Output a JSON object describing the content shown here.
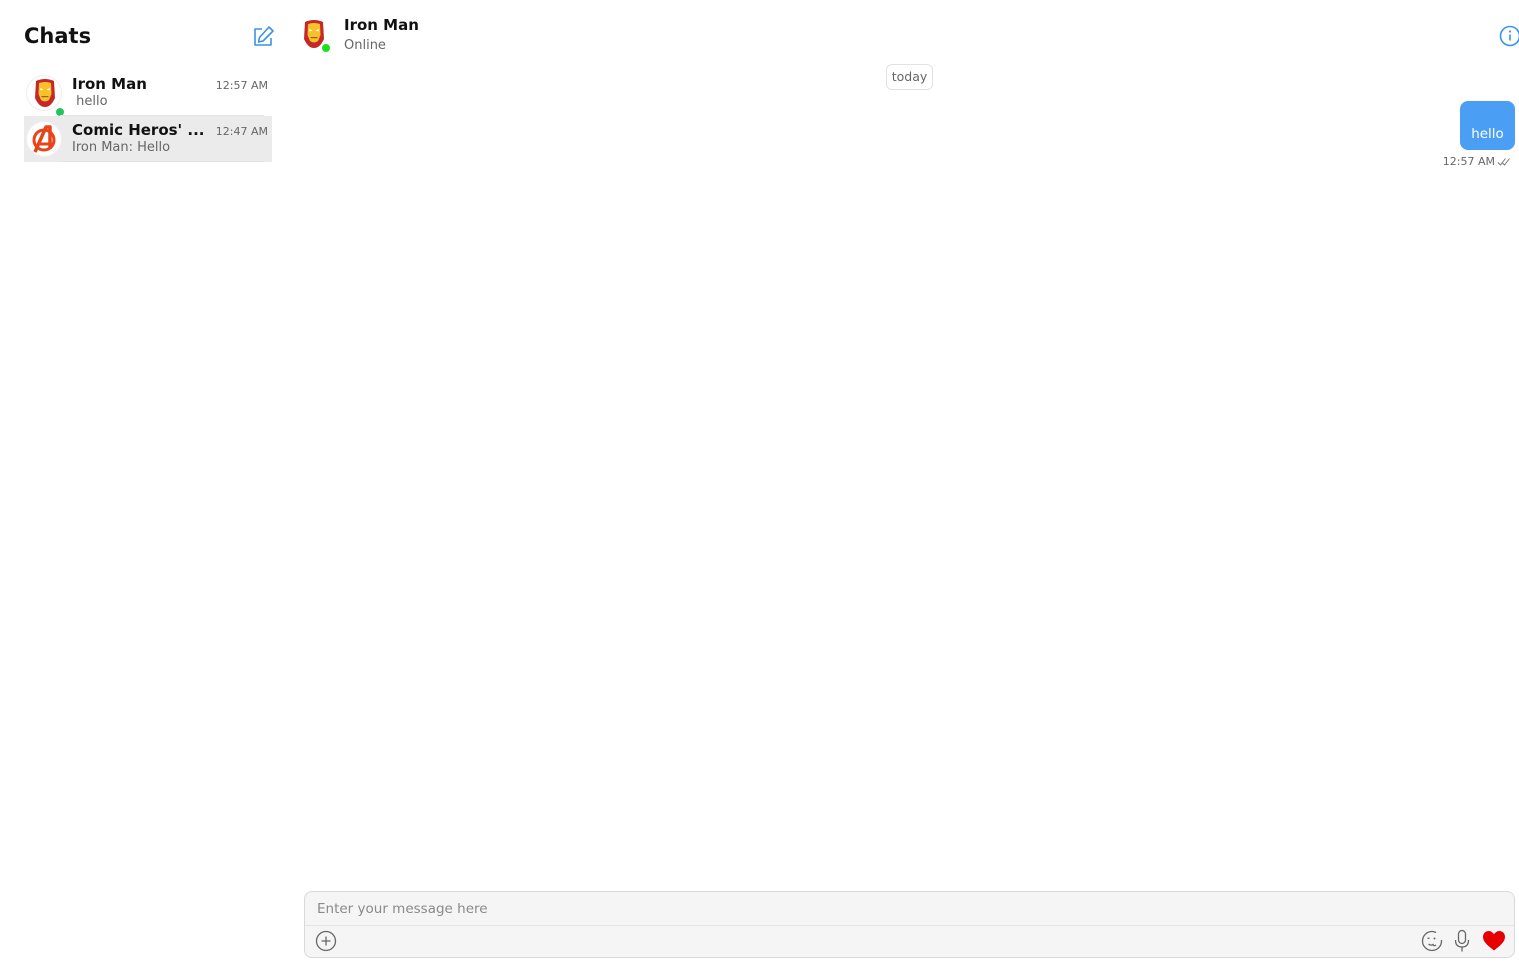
{
  "sidebar": {
    "title": "Chats",
    "compose_icon": "compose-edit-icon",
    "chats": [
      {
        "name": "Iron Man",
        "preview": " hello",
        "time": "12:57 AM",
        "avatar": "iron-man-avatar",
        "online": true
      },
      {
        "name": "Comic Heros' ...",
        "preview": "Iron Man: Hello",
        "time": "12:47 AM",
        "avatar": "avengers-avatar",
        "online": false
      }
    ]
  },
  "conversation": {
    "name": "Iron Man",
    "status": "Online",
    "info_icon": "info-icon",
    "date_separator": "today",
    "messages": [
      {
        "text": "hello",
        "time": "12:57 AM",
        "outgoing": true,
        "read_icon": "double-check-icon"
      }
    ]
  },
  "composer": {
    "placeholder": "Enter your message here",
    "icons": [
      "add-circle-icon",
      "emoji-icon",
      "microphone-icon",
      "heart-icon"
    ]
  },
  "colors": {
    "accent": "#4a9ff5",
    "online": "#22c55e",
    "heart": "#e60000",
    "selected_row": "#ebebeb"
  }
}
